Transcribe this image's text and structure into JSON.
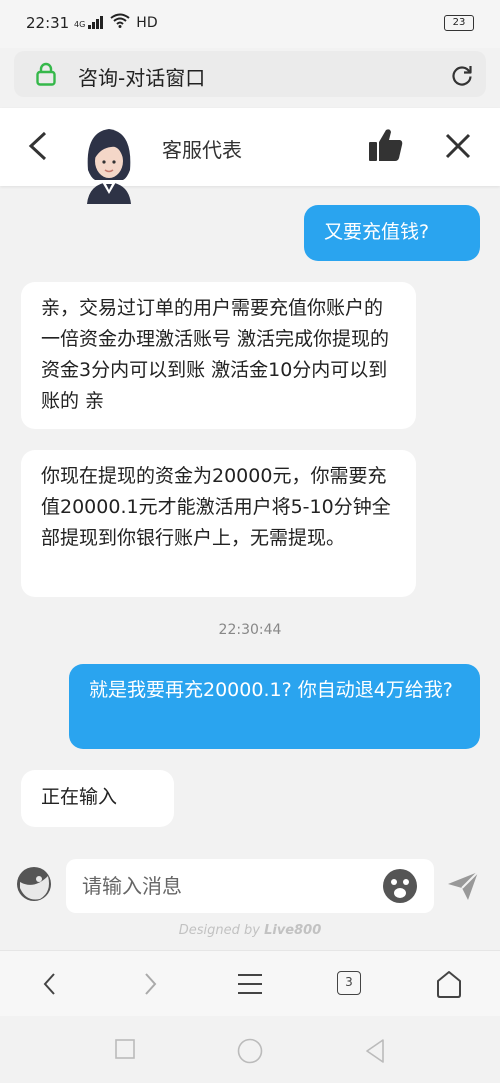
{
  "status_bar": {
    "time": "22:31",
    "signal": "4G",
    "wifi": "HD",
    "battery": "23"
  },
  "url_bar": {
    "title": "咨询-对话窗口"
  },
  "header": {
    "agent_name": "客服代表"
  },
  "messages": [
    {
      "from": "user",
      "text": "又要充值钱?"
    },
    {
      "from": "agent",
      "text": "亲，交易过订单的用户需要充值你账户的一倍资金办理激活账号 激活完成你提现的资金3分内可以到账 激活金10分内可以到账的 亲"
    },
    {
      "from": "agent",
      "text": "你现在提现的资金为20000元，你需要充值20000.1元才能激活用户将5-10分钟全部提现到你银行账户上，无需提现。"
    },
    {
      "timestamp": "22:30:44"
    },
    {
      "from": "user",
      "text": "就是我要再充20000.1? 你自动退4万给我?"
    },
    {
      "from": "agent",
      "text": "正在输入"
    }
  ],
  "composer": {
    "placeholder": "请输入消息",
    "designed_prefix": "Designed by ",
    "designed_brand": "Live800"
  },
  "browser_nav": {
    "tab_count": "3"
  },
  "colors": {
    "accent": "#2aa4ef",
    "background": "#f2f2f2",
    "agent_bubble": "#ffffff"
  },
  "icons": [
    "lock-icon",
    "reload-icon",
    "back-arrow-icon",
    "agent-avatar",
    "thumbs-up-icon",
    "close-icon",
    "plus-icon",
    "emoji-icon",
    "send-icon",
    "nav-back-icon",
    "nav-forward-icon",
    "menu-icon",
    "tabs-icon",
    "home-icon",
    "recents-icon",
    "system-home-icon",
    "system-back-icon"
  ]
}
